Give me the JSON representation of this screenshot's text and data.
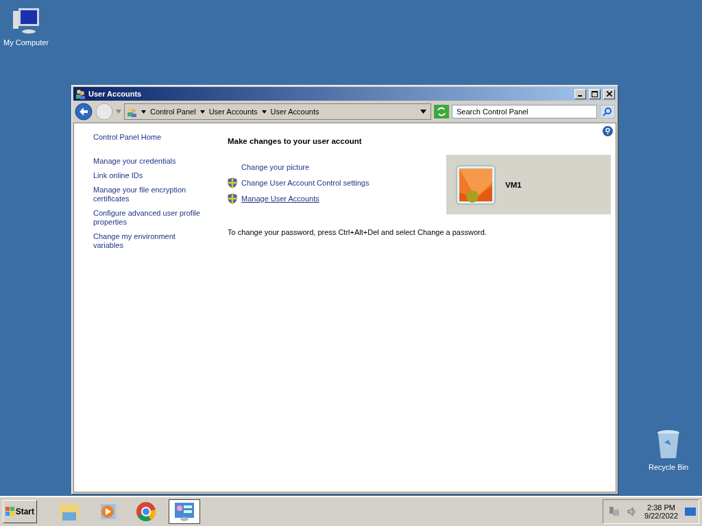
{
  "desktop_icons": [
    {
      "kind": "computer",
      "label": "My Computer"
    },
    {
      "kind": "recycle",
      "label": "Recycle Bin"
    }
  ],
  "window": {
    "title": "User Accounts",
    "address": {
      "crumbs": [
        "Control Panel",
        "User Accounts",
        "User Accounts"
      ]
    },
    "search": {
      "placeholder": "Search Control Panel"
    },
    "sidebar": {
      "home": "Control Panel Home",
      "links": [
        "Manage your credentials",
        "Link online IDs",
        "Manage your file encryption certificates",
        "Configure advanced user profile properties",
        "Change my environment variables"
      ]
    },
    "heading": "Make changes to your user account",
    "tasks": [
      {
        "label": "Change your picture",
        "shield": false,
        "hovered": false
      },
      {
        "label": "Change User Account Control settings",
        "shield": true,
        "hovered": false
      },
      {
        "label": "Manage User Accounts",
        "shield": true,
        "hovered": true
      }
    ],
    "note": "To change your password, press Ctrl+Alt+Del and select Change a password.",
    "account": {
      "name": "VM1"
    }
  },
  "taskbar": {
    "start": "Start",
    "apps": [
      {
        "kind": "explorer",
        "selected": false
      },
      {
        "kind": "media",
        "selected": false
      },
      {
        "kind": "chrome",
        "selected": false
      },
      {
        "kind": "control",
        "selected": true
      }
    ],
    "time": "2:38 PM",
    "date": "9/22/2022"
  }
}
